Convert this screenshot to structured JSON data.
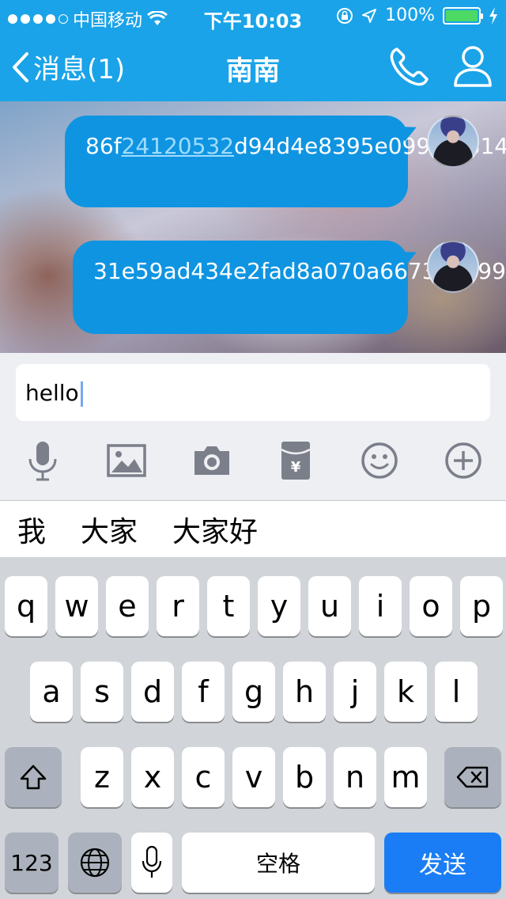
{
  "status_bar": {
    "carrier": "中国移动",
    "time": "下午10:03",
    "battery": "100%"
  },
  "nav": {
    "back_label": "消息(1)",
    "title": "南南"
  },
  "messages": [
    {
      "prefix": "86f",
      "link": "24120532",
      "suffix": "d94d4e8395e09942f8147"
    },
    {
      "text": "31e59ad434e2fad8a070a66738a999da"
    }
  ],
  "input": {
    "value": "hello"
  },
  "toolbar": {
    "icons": [
      "microphone-icon",
      "image-icon",
      "camera-icon",
      "red-packet-icon",
      "emoji-icon",
      "plus-icon"
    ]
  },
  "candidates": [
    "我",
    "大家",
    "大家好"
  ],
  "keyboard": {
    "row1": [
      "q",
      "w",
      "e",
      "r",
      "t",
      "y",
      "u",
      "i",
      "o",
      "p"
    ],
    "row2": [
      "a",
      "s",
      "d",
      "f",
      "g",
      "h",
      "j",
      "k",
      "l"
    ],
    "row3": [
      "z",
      "x",
      "c",
      "v",
      "b",
      "n",
      "m"
    ],
    "num_label": "123",
    "space_label": "空格",
    "send_label": "发送"
  },
  "colors": {
    "header": "#1aa3e8",
    "bubble": "#0f94e1",
    "send_key": "#1a7df5",
    "battery": "#4cd964"
  }
}
